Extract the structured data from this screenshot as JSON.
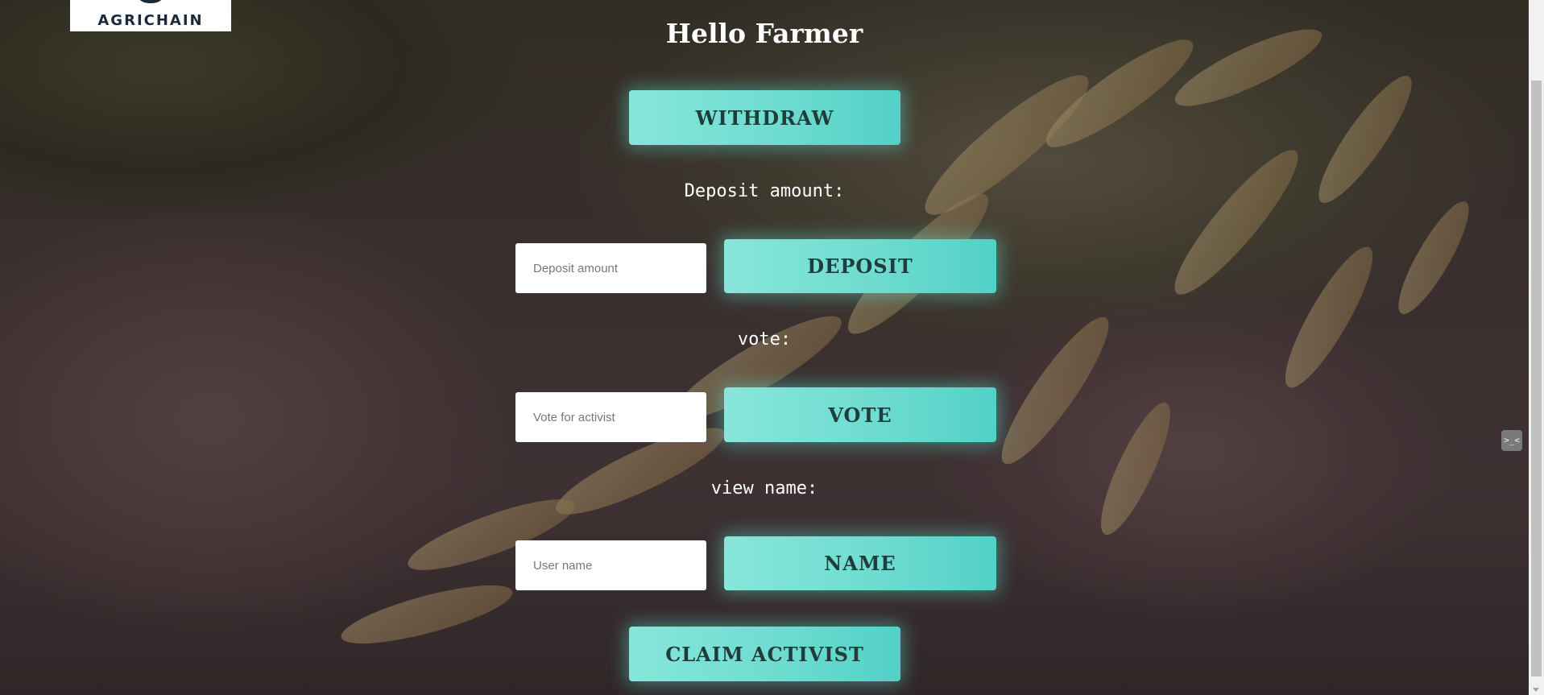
{
  "logo": {
    "text": "AGRICHAIN"
  },
  "page": {
    "title": "Hello Farmer"
  },
  "withdraw": {
    "button_label": "WITHDRAW"
  },
  "deposit": {
    "label": "Deposit amount:",
    "placeholder": "Deposit amount",
    "value": "",
    "button_label": "DEPOSIT"
  },
  "vote": {
    "label": "vote:",
    "placeholder": "Vote for activist",
    "value": "",
    "button_label": "VOTE"
  },
  "name": {
    "label": "view name:",
    "placeholder": "User name",
    "value": "",
    "button_label": "NAME"
  },
  "claim": {
    "button_label": "CLAIM ACTIVIST"
  },
  "colors": {
    "accent": "#6fdcd0",
    "button_text": "#1f3d3a",
    "text": "#ffffff"
  },
  "icons": {
    "extension": "code-extension-icon",
    "scroll_down": "scroll-down-arrow-icon"
  },
  "extension": {
    "glyph": ">_<"
  }
}
